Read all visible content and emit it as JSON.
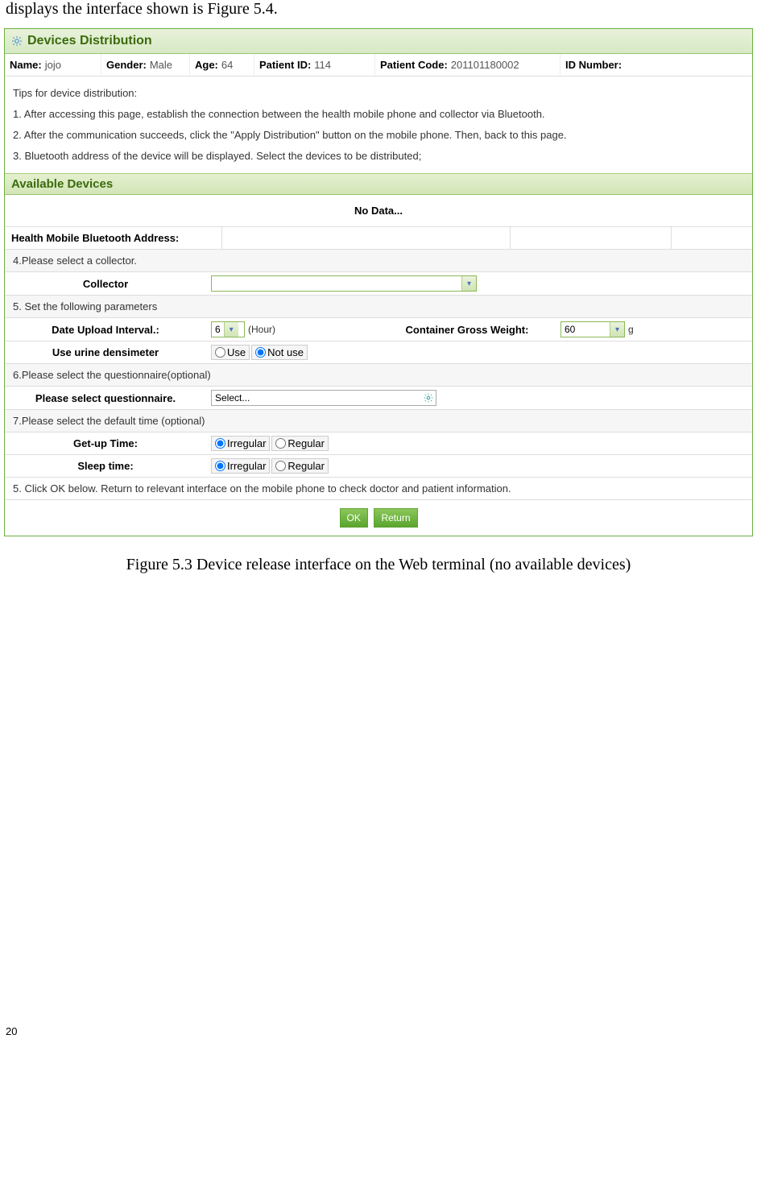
{
  "intro_text": "displays the interface shown is Figure 5.4.",
  "panel_title": "Devices Distribution",
  "patient": {
    "labels": {
      "name": "Name:",
      "gender": "Gender:",
      "age": "Age:",
      "pid": "Patient ID:",
      "pcode": "Patient Code:",
      "idnum": "ID Number:"
    },
    "values": {
      "name": "jojo",
      "gender": "Male",
      "age": "64",
      "pid": "114",
      "pcode": "201101180002",
      "idnum": ""
    }
  },
  "tips": {
    "heading": "Tips for device distribution:",
    "items": [
      "1. After accessing this page, establish the connection between the health mobile phone and collector via Bluetooth.",
      "2. After the communication succeeds, click the \"Apply Distribution\" button on the mobile phone. Then, back to this page.",
      "3. Bluetooth address of the device will be displayed. Select the devices to be distributed;"
    ]
  },
  "available_header": "Available Devices",
  "no_data": "No Data...",
  "hba_label": "Health Mobile Bluetooth Address:",
  "steps": {
    "s4": "4.Please select a collector.",
    "collector_label": "Collector",
    "s5": "5. Set the following parameters",
    "dui_label": "Date Upload Interval.:",
    "dui_value": "6",
    "dui_suffix": "(Hour)",
    "cgw_label": "Container Gross Weight:",
    "cgw_value": "60",
    "cgw_suffix": "g",
    "densimeter_label": "Use urine densimeter",
    "radio_use": "Use",
    "radio_notuse": "Not use",
    "s6": "6.Please select the questionnaire(optional)",
    "qn_label": "Please select questionnaire.",
    "qn_placeholder": "Select...",
    "s7": "7.Please select the default time (optional)",
    "getup_label": "Get-up Time:",
    "sleep_label": "Sleep time:",
    "radio_irregular": "Irregular",
    "radio_regular": "Regular",
    "s5b": "5. Click OK below. Return to relevant interface on the mobile phone to check doctor and patient information."
  },
  "buttons": {
    "ok": "OK",
    "return": "Return"
  },
  "caption": "Figure 5.3 Device release interface on the Web terminal (no available devices)",
  "page_number": "20"
}
